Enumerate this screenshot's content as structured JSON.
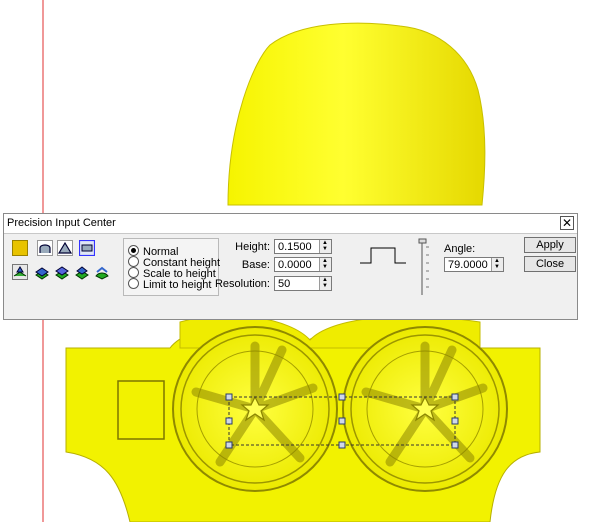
{
  "dialog": {
    "title": "Precision Input Center",
    "close_glyph": "✕",
    "modes": [
      "Normal",
      "Constant height",
      "Scale to height",
      "Limit to height"
    ],
    "selected_mode": 0,
    "height_label": "Height:",
    "height_value": "0.1500",
    "base_label": "Base:",
    "base_value": "0.0000",
    "resolution_label": "Resolution:",
    "resolution_value": "50",
    "angle_label": "Angle:",
    "angle_value": "79.0000",
    "apply_label": "Apply",
    "close_label": "Close"
  },
  "colors": {
    "model": "#f2f200",
    "model_shade": "#a9a400",
    "guide_line": "#e03030",
    "swatch": "#e8c300"
  },
  "icons": [
    "color-swatch-icon",
    "dome-profile-icon",
    "cone-profile-icon",
    "flat-profile-icon",
    "layer-tool-icon",
    "layer-add-icon",
    "layer-merge-icon",
    "layer-subtract-icon",
    "layer-smooth-icon",
    "step-profile-icon",
    "slider-track-icon"
  ]
}
